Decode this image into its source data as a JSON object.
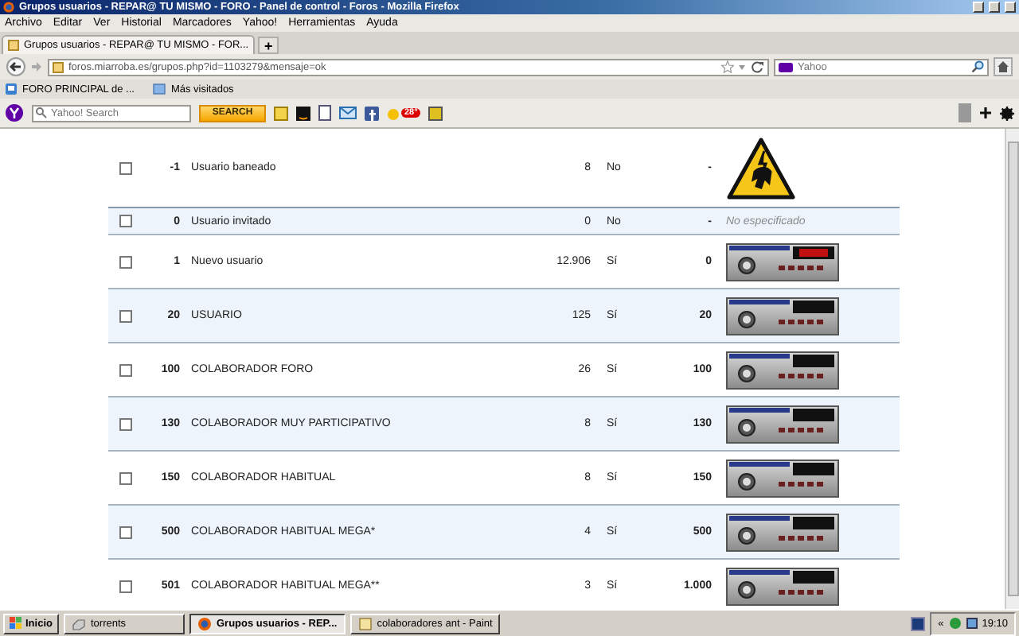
{
  "window": {
    "title": "Grupos usuarios - REPAR@ TU MISMO - FORO - Panel de control - Foros - Mozilla Firefox"
  },
  "menu": [
    "Archivo",
    "Editar",
    "Ver",
    "Historial",
    "Marcadores",
    "Yahoo!",
    "Herramientas",
    "Ayuda"
  ],
  "tabs": [
    {
      "label": "Grupos usuarios - REPAR@ TU MISMO - FOR...",
      "selected": true
    }
  ],
  "new_tab": "+",
  "address_bar": {
    "value": "foros.miarroba.es/grupos.php?id=1103279&mensaje=ok"
  },
  "search": {
    "placeholder": "Yahoo"
  },
  "bookmarks": [
    "FORO PRINCIPAL de ...",
    "Más visitados"
  ],
  "yahoo_toolbar": {
    "search_placeholder": "Yahoo! Search",
    "search_button": "SEARCH",
    "weather_badge": "28°"
  },
  "table": {
    "rows": [
      {
        "checked": false,
        "id": "-1",
        "name": "Usuario baneado",
        "count": "8",
        "visible": "No",
        "value": "-",
        "kind": "warning"
      },
      {
        "checked": false,
        "id": "0",
        "name": "Usuario invitado",
        "count": "0",
        "visible": "No",
        "value": "-",
        "kind": "none",
        "image_text": "No especificado"
      },
      {
        "checked": false,
        "id": "1",
        "name": "Nuevo usuario",
        "count": "12.906",
        "visible": "Sí",
        "value": "0",
        "kind": "rank_new"
      },
      {
        "checked": false,
        "id": "20",
        "name": "USUARIO",
        "count": "125",
        "visible": "Sí",
        "value": "20",
        "kind": "rank"
      },
      {
        "checked": false,
        "id": "100",
        "name": "COLABORADOR FORO",
        "count": "26",
        "visible": "Sí",
        "value": "100",
        "kind": "rank"
      },
      {
        "checked": false,
        "id": "130",
        "name": "COLABORADOR MUY PARTICIPATIVO",
        "count": "8",
        "visible": "Sí",
        "value": "130",
        "kind": "rank"
      },
      {
        "checked": false,
        "id": "150",
        "name": "COLABORADOR HABITUAL",
        "count": "8",
        "visible": "Sí",
        "value": "150",
        "kind": "rank"
      },
      {
        "checked": false,
        "id": "500",
        "name": "COLABORADOR HABITUAL MEGA*",
        "count": "4",
        "visible": "Sí",
        "value": "500",
        "kind": "rank"
      },
      {
        "checked": false,
        "id": "501",
        "name": "COLABORADOR HABITUAL MEGA**",
        "count": "3",
        "visible": "Sí",
        "value": "1.000",
        "kind": "rank"
      }
    ]
  },
  "taskbar": {
    "start": "Inicio",
    "tasks": [
      {
        "label": "torrents",
        "selected": false
      },
      {
        "label": "Grupos usuarios - REP...",
        "selected": true
      },
      {
        "label": "colaboradores ant - Paint",
        "selected": false
      }
    ],
    "tray_toggle": "«",
    "clock": "19:10"
  }
}
